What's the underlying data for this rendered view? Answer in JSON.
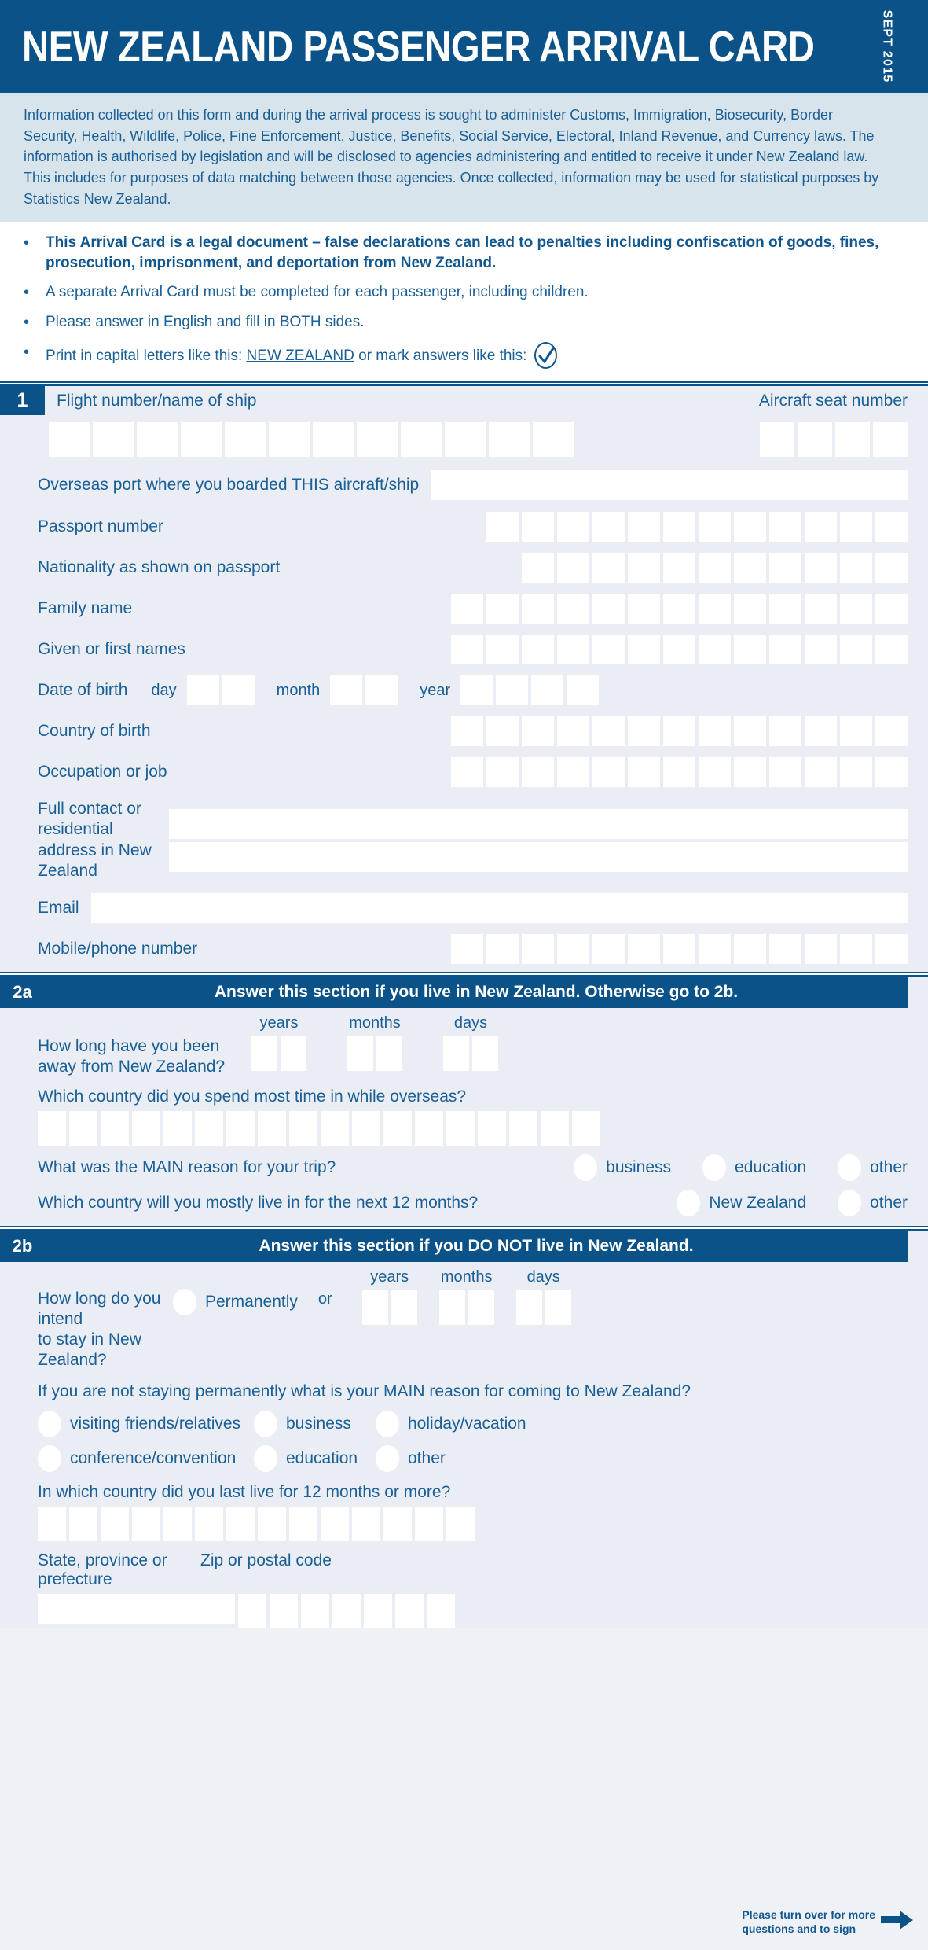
{
  "header": {
    "title": "NEW ZEALAND PASSENGER ARRIVAL CARD",
    "date": "SEPT 2015",
    "bg_color": "#0b5289",
    "text_color": "#ffffff"
  },
  "intro": {
    "paragraph": "Information collected on this form and during the arrival process is sought to administer Customs, Immigration, Biosecurity, Border Security, Health, Wildlife, Police, Fine Enforcement, Justice, Benefits, Social Service, Electoral, Inland Revenue, and Currency laws. The information is authorised by legislation and will be disclosed to agencies administering and entitled to receive it under New Zealand law. This includes for purposes of data matching between those agencies. Once collected, information may be used for statistical purposes by Statistics New Zealand.",
    "bg_color": "#d8e4ec",
    "text_color": "#1a5f96"
  },
  "bullets": [
    {
      "text": "This Arrival Card is a legal document – false declarations can lead to penalties including confiscation of goods, fines, prosecution, imprisonment, and deportation from New Zealand.",
      "bold": true
    },
    {
      "text": "A separate Arrival Card must be completed for each passenger, including children.",
      "bold": false
    },
    {
      "text": "Please answer in English and fill in BOTH sides.",
      "bold": false
    },
    {
      "prefix": "Print in capital letters like this:",
      "sample": "NEW ZEALAND",
      "suffix": "or mark answers like this:",
      "icon": "check-mark-oval-icon",
      "bold": false
    }
  ],
  "section1": {
    "number": "1",
    "flight_label": "Flight number/name of ship",
    "flight_boxes": 12,
    "seat_label": "Aircraft seat number",
    "seat_boxes": 4,
    "rows": [
      {
        "label": "Overseas port where you boarded THIS aircraft/ship",
        "type": "wide",
        "name": "overseas-port"
      },
      {
        "label": "Passport number",
        "type": "boxes",
        "boxes": 12,
        "name": "passport-number"
      },
      {
        "label": "Nationality as shown on passport",
        "type": "boxes",
        "boxes": 11,
        "name": "nationality"
      },
      {
        "label": "Family name",
        "type": "boxes",
        "boxes": 13,
        "name": "family-name"
      },
      {
        "label": "Given or first names",
        "type": "boxes",
        "boxes": 13,
        "name": "given-names"
      }
    ],
    "dob": {
      "label": "Date of birth",
      "day_label": "day",
      "day_boxes": 2,
      "month_label": "month",
      "month_boxes": 2,
      "year_label": "year",
      "year_boxes": 4
    },
    "rows2": [
      {
        "label": "Country of birth",
        "type": "boxes",
        "boxes": 13,
        "name": "country-of-birth"
      },
      {
        "label": "Occupation or job",
        "type": "boxes",
        "boxes": 13,
        "name": "occupation"
      }
    ],
    "address": {
      "label_line1": "Full contact or residential",
      "label_line2": "address in New Zealand",
      "lines": 2
    },
    "email_label": "Email",
    "phone_label": "Mobile/phone number",
    "phone_boxes": 13
  },
  "section2a": {
    "number": "2a",
    "banner": "Answer this section if you live in New Zealand. Otherwise go to 2b.",
    "q1": {
      "label_line1": "How long have you been",
      "label_line2": "away from New Zealand?",
      "years_label": "years",
      "years_boxes": 2,
      "months_label": "months",
      "months_boxes": 2,
      "days_label": "days",
      "days_boxes": 2
    },
    "q2": {
      "label": "Which country did you spend most time in while overseas?",
      "boxes": 18
    },
    "q3": {
      "label": "What was the MAIN reason for your trip?",
      "options": [
        "business",
        "education",
        "other"
      ]
    },
    "q4": {
      "label": "Which country will you mostly live in for the next 12 months?",
      "options": [
        "New Zealand",
        "other"
      ]
    }
  },
  "section2b": {
    "number": "2b",
    "banner": "Answer this section if you DO NOT live in New Zealand.",
    "q1": {
      "label_line1": "How long do you intend",
      "label_line2": "to stay in New Zealand?",
      "permanently_label": "Permanently",
      "or_label": "or",
      "years_label": "years",
      "years_boxes": 2,
      "months_label": "months",
      "months_boxes": 2,
      "days_label": "days",
      "days_boxes": 2
    },
    "q2": {
      "label": "If you are not staying permanently what is your MAIN reason for coming to New Zealand?",
      "options_row1": [
        "visiting friends/relatives",
        "business",
        "holiday/vacation"
      ],
      "options_row2": [
        "conference/convention",
        "education",
        "other"
      ]
    },
    "q3": {
      "label": "In which country did you last live for 12 months or more?",
      "boxes": 14
    },
    "q4": {
      "state_label": "State, province or prefecture",
      "zip_label": "Zip or postal code",
      "zip_boxes": 7
    }
  },
  "footer": {
    "line1": "Please turn over for more",
    "line2": "questions and to sign",
    "icon": "right-arrow-icon"
  }
}
